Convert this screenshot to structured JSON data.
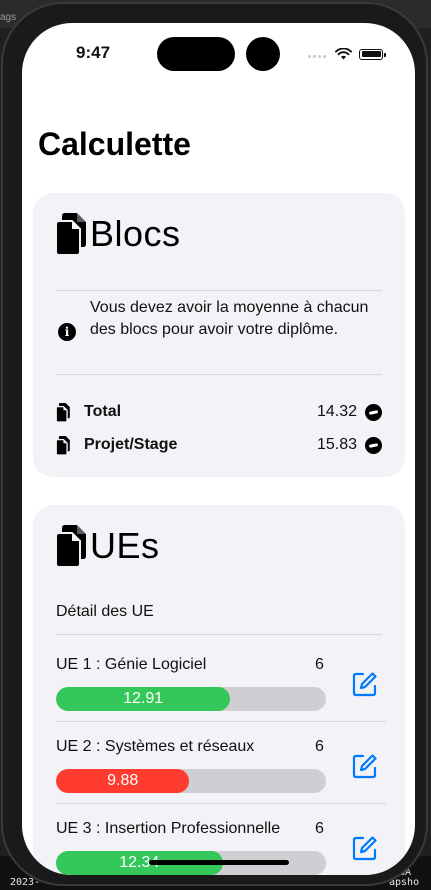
{
  "host": {
    "top_fragment": "ags",
    "bottom_left": "2023-",
    "bottom_right_1": "s-BA",
    "bottom_right_2": "apsho"
  },
  "status_bar": {
    "time": "9:47"
  },
  "nav": {
    "title": "Calculette"
  },
  "blocs": {
    "heading": "Blocs",
    "info_text": "Vous devez avoir la moyenne à chacun des blocs pour avoir votre diplôme.",
    "items": [
      {
        "name": "Total",
        "average": "14.32",
        "icon": "passed-badge-icon"
      },
      {
        "name": "Projet/Stage",
        "average": "15.83",
        "icon": "passed-badge-icon"
      }
    ]
  },
  "ues": {
    "heading": "UEs",
    "detail_label": "Détail des UE",
    "items": [
      {
        "name": "UE 1 : Génie Logiciel",
        "coef": "6",
        "grade": "12.91",
        "grade_fraction": 0.6455,
        "status_color": "#34c759"
      },
      {
        "name": "UE 2 : Systèmes et réseaux",
        "coef": "6",
        "grade": "9.88",
        "grade_fraction": 0.494,
        "status_color": "#ff3b30"
      },
      {
        "name": "UE 3 : Insertion Professionnelle",
        "coef": "6",
        "grade": "12.34",
        "grade_fraction": 0.617,
        "status_color": "#34c759"
      }
    ]
  },
  "colors": {
    "accent": "#007aff",
    "pass": "#34c759",
    "fail": "#ff3b30",
    "track": "#cfcfd3",
    "card_background": "#f2f2f7"
  }
}
